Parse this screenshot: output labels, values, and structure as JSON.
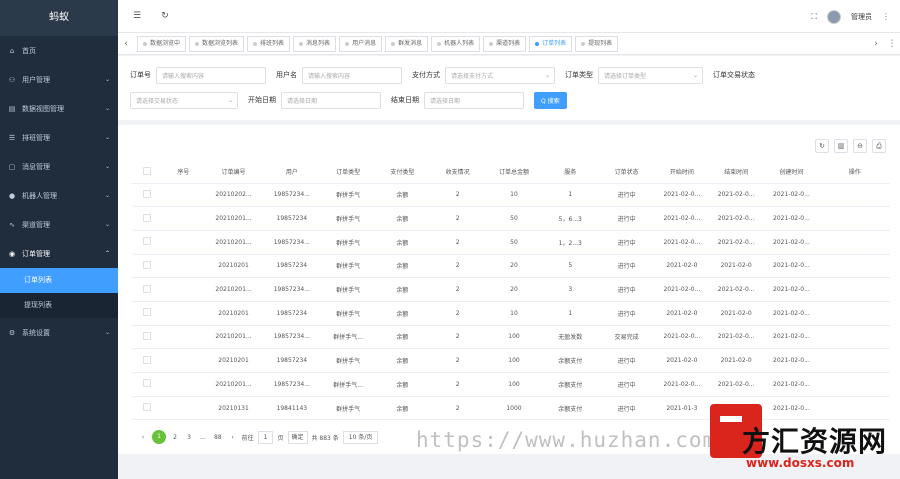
{
  "app": {
    "logo": "蚂蚁"
  },
  "sidebar": {
    "items": [
      {
        "icon": "home-icon",
        "glyph": "⌂",
        "label": "首页",
        "arrow": ""
      },
      {
        "icon": "user-icon",
        "glyph": "⚇",
        "label": "用户管理",
        "arrow": "⌄"
      },
      {
        "icon": "chart-icon",
        "glyph": "▤",
        "label": "数据视图管理",
        "arrow": "⌄"
      },
      {
        "icon": "list-icon",
        "glyph": "☰",
        "label": "排班管理",
        "arrow": "⌄"
      },
      {
        "icon": "comment-icon",
        "glyph": "▢",
        "label": "消息管理",
        "arrow": "⌄"
      },
      {
        "icon": "robot-icon",
        "glyph": "●",
        "label": "机器人管理",
        "arrow": "⌄"
      },
      {
        "icon": "activity-icon",
        "glyph": "∿",
        "label": "渠道管理",
        "arrow": "⌄"
      },
      {
        "icon": "order-icon",
        "glyph": "◉",
        "label": "订单管理",
        "arrow": "⌃"
      }
    ],
    "submenu": [
      {
        "label": "订单列表",
        "active": true
      },
      {
        "label": "提现列表",
        "active": false
      }
    ],
    "settings": {
      "icon": "settings-icon",
      "glyph": "⚙",
      "label": "系统设置",
      "arrow": "⌄"
    }
  },
  "header": {
    "user_name": "管理员"
  },
  "tags": [
    {
      "label": "数据浏览中",
      "active": false
    },
    {
      "label": "数据浏览列表",
      "active": false
    },
    {
      "label": "排班列表",
      "active": false
    },
    {
      "label": "消息列表",
      "active": false
    },
    {
      "label": "用户消息",
      "active": false
    },
    {
      "label": "群发消息",
      "active": false
    },
    {
      "label": "机器人列表",
      "active": false
    },
    {
      "label": "渠道列表",
      "active": false
    },
    {
      "label": "订单列表",
      "active": true
    },
    {
      "label": "提现列表",
      "active": false
    }
  ],
  "search": {
    "order_no_label": "订单号",
    "order_no_placeholder": "请输入搜索内容",
    "user_label": "用户名",
    "user_placeholder": "请输入搜索内容",
    "pay_label": "支付方式",
    "pay_placeholder": "请选择支付方式",
    "type_label": "订单类型",
    "type_placeholder": "请选择订单类型",
    "status_label": "订单交易状态",
    "status_placeholder": "请选择交易状态",
    "start_label": "开始日期",
    "start_placeholder": "请选择日期",
    "end_label": "结束日期",
    "end_placeholder": "请选择日期",
    "search_button": "Q 搜索"
  },
  "table": {
    "columns": [
      "",
      "序号",
      "订单编号",
      "用户",
      "订单类型",
      "支付类型",
      "收支情况",
      "订单总金额",
      "服务",
      "订单状态",
      "开始时间",
      "结束时间",
      "创建时间",
      "操作"
    ],
    "rows": [
      [
        "",
        "",
        "20210202...",
        "19857234...",
        "群拼手气",
        "余额",
        "2",
        "10",
        "1",
        "进行中",
        "2021-02-0...",
        "2021-02-0...",
        "2021-02-0...",
        ""
      ],
      [
        "",
        "",
        "20210201...",
        "19857234",
        "群拼手气",
        "余额",
        "2",
        "50",
        "5，6...3",
        "进行中",
        "2021-02-0...",
        "2021-02-0...",
        "2021-02-0...",
        ""
      ],
      [
        "",
        "",
        "20210201...",
        "19857234...",
        "群拼手气",
        "余额",
        "2",
        "50",
        "1，2...3",
        "进行中",
        "2021-02-0...",
        "2021-02-0...",
        "2021-02-0...",
        ""
      ],
      [
        "",
        "",
        "20210201",
        "19857234",
        "群拼手气",
        "余额",
        "2",
        "20",
        "5",
        "进行中",
        "2021-02-0",
        "2021-02-0",
        "2021-02-0...",
        ""
      ],
      [
        "",
        "",
        "20210201...",
        "19857234...",
        "群拼手气",
        "余额",
        "2",
        "20",
        "3",
        "进行中",
        "2021-02-0...",
        "2021-02-0...",
        "2021-02-0...",
        ""
      ],
      [
        "",
        "",
        "20210201",
        "19857234",
        "群拼手气",
        "余额",
        "2",
        "10",
        "1",
        "进行中",
        "2021-02-0",
        "2021-02-0",
        "2021-02-0...",
        ""
      ],
      [
        "",
        "",
        "20210201...",
        "19857234...",
        "群拼手气...",
        "余额",
        "2",
        "100",
        "无盈发数",
        "交易完成",
        "2021-02-0...",
        "2021-02-0...",
        "2021-02-0...",
        ""
      ],
      [
        "",
        "",
        "20210201",
        "19857234",
        "群拼手气",
        "余额",
        "2",
        "100",
        "余额支付",
        "进行中",
        "2021-02-0",
        "2021-02-0",
        "2021-02-0...",
        ""
      ],
      [
        "",
        "",
        "20210201...",
        "19857234...",
        "群拼手气...",
        "余额",
        "2",
        "100",
        "余额支付",
        "进行中",
        "2021-02-0...",
        "2021-02-0...",
        "2021-02-0...",
        ""
      ],
      [
        "",
        "",
        "20210131",
        "19841143",
        "群拼手气",
        "余额",
        "2",
        "1000",
        "余额支付",
        "进行中",
        "2021-01-3",
        "2021-02-0",
        "2021-02-0...",
        ""
      ]
    ]
  },
  "pagination": {
    "pages": [
      "1",
      "2",
      "3",
      "...",
      "88"
    ],
    "goto_label": "前往",
    "page_input": "1",
    "page_unit": "页",
    "confirm": "确定",
    "total": "共 883 条",
    "page_size": "10 条/页"
  },
  "watermark": {
    "url_text": "https://www.huzhan.com",
    "logo_title": "方汇资源网",
    "logo_url": "www.dosxs.com"
  }
}
